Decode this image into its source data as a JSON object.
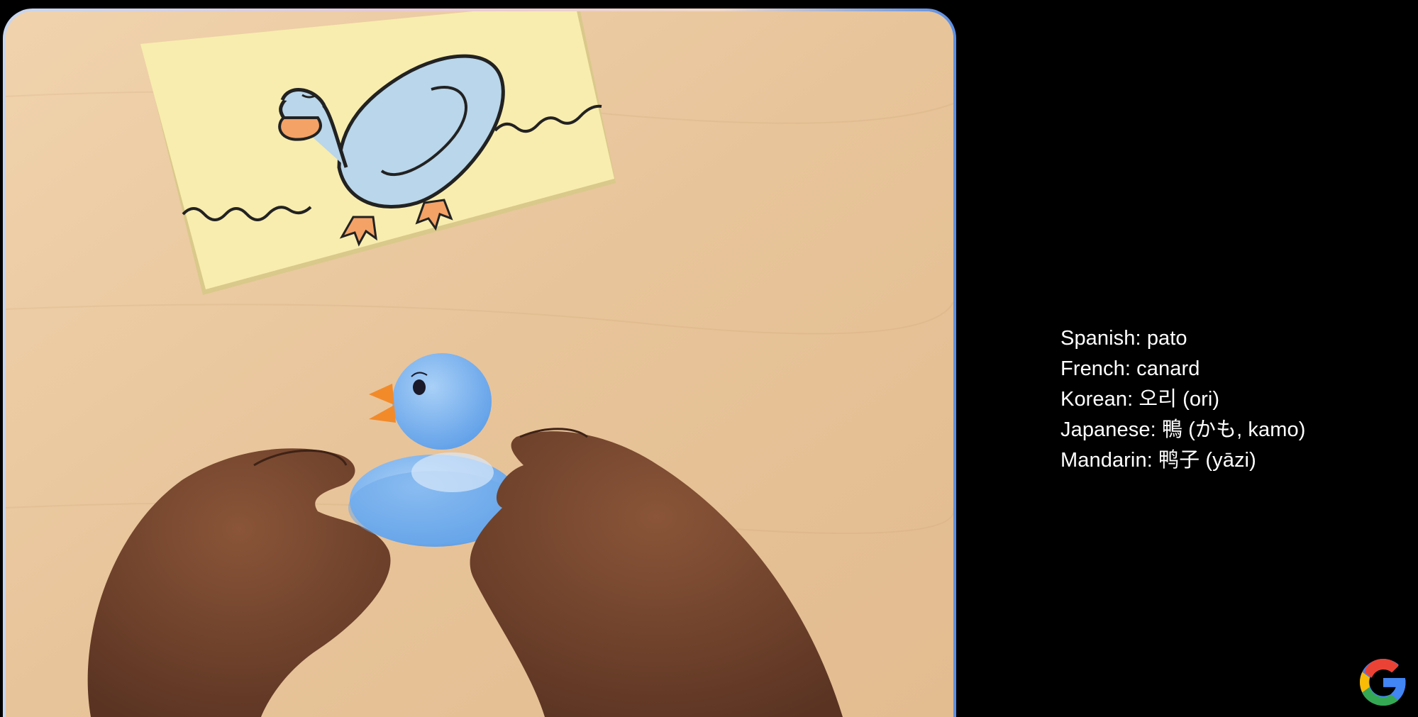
{
  "caption": {
    "lines": [
      "Spanish: pato",
      "French: canard",
      "Korean: 오리 (ori)",
      "Japanese: 鴨 (かも, kamo)",
      "Mandarin: 鸭子 (yāzi)"
    ]
  },
  "logo": {
    "icon": "google-g-icon"
  },
  "colors": {
    "background": "#000000",
    "table_wood": "#e9c9a1",
    "sticky_note": "#f8edae",
    "duck_blue": "#7fb4ee",
    "beak_orange": "#f28a2a",
    "skin": "#6b3f2a"
  }
}
